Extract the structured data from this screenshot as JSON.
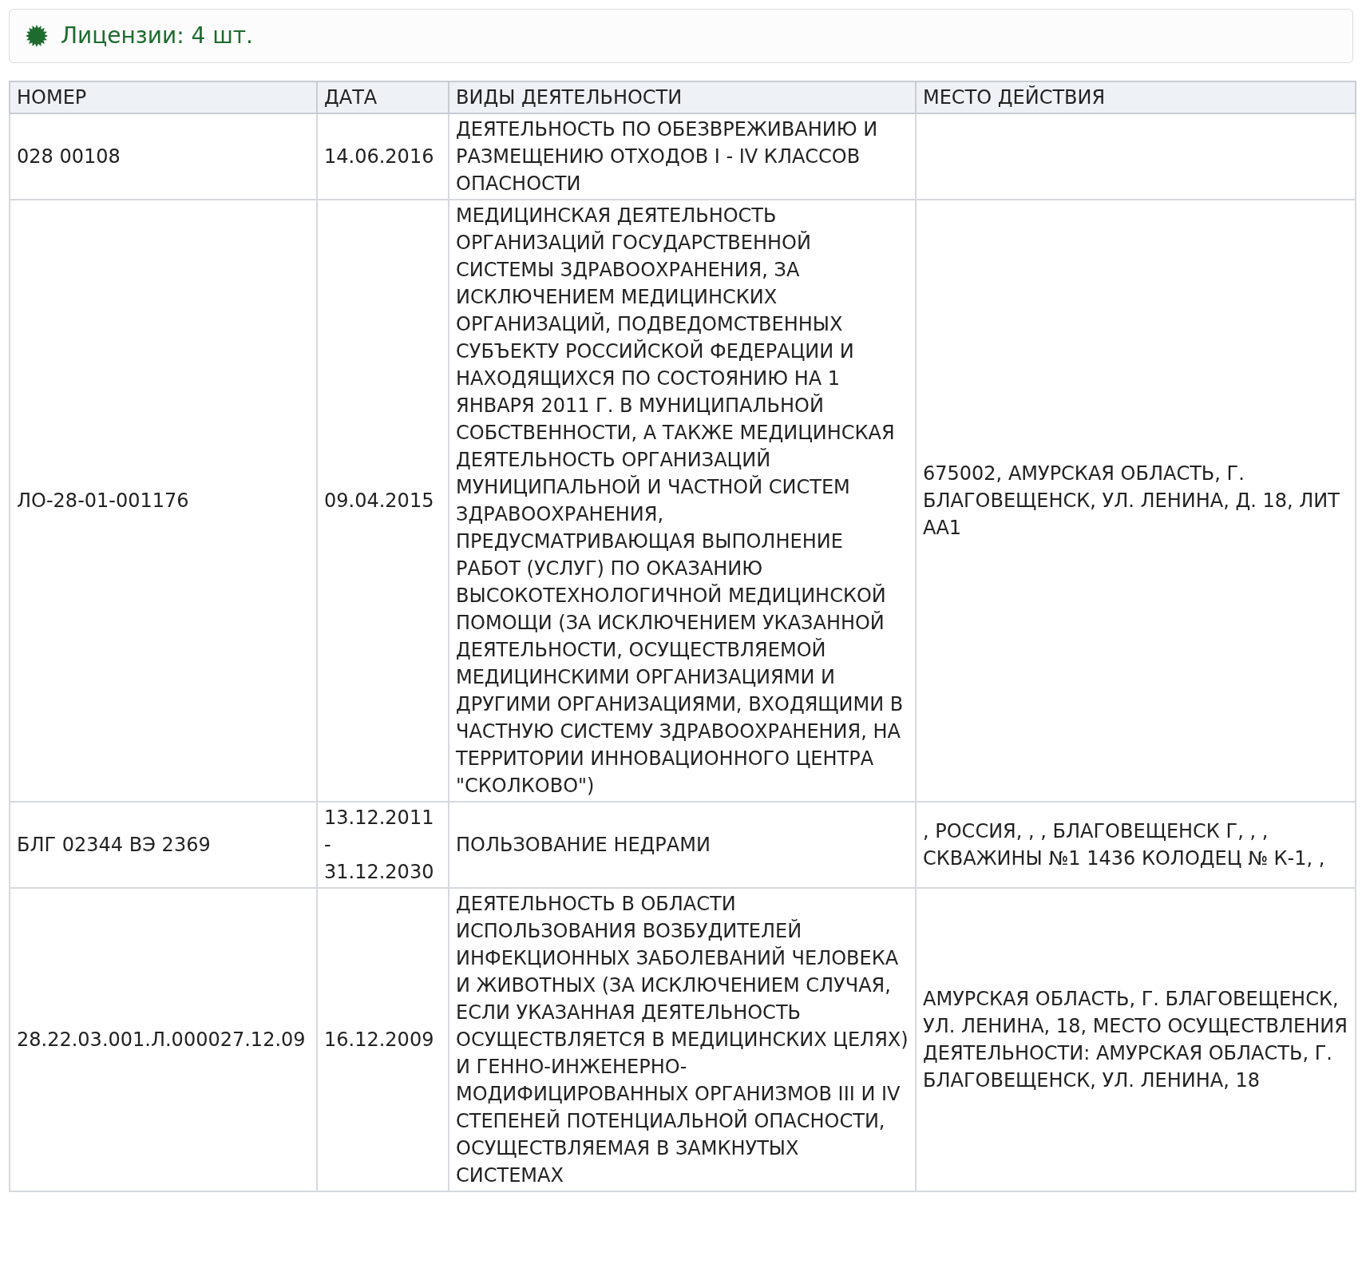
{
  "header": {
    "title": "Лицензии: 4 шт."
  },
  "table": {
    "columns": [
      "НОМЕР",
      "ДАТА",
      "ВИДЫ ДЕЯТЕЛЬНОСТИ",
      "МЕСТО ДЕЙСТВИЯ"
    ],
    "rows": [
      {
        "number": "028 00108",
        "date": "14.06.2016",
        "activity": "ДЕЯТЕЛЬНОСТЬ ПО ОБЕЗВРЕЖИВАНИЮ И РАЗМЕЩЕНИЮ ОТХОДОВ I - IV КЛАССОВ ОПАСНОСТИ",
        "place": ""
      },
      {
        "number": "ЛО-28-01-001176",
        "date": "09.04.2015",
        "activity": "МЕДИЦИНСКАЯ ДЕЯТЕЛЬНОСТЬ ОРГАНИЗАЦИЙ ГОСУДАРСТВЕННОЙ СИСТЕМЫ ЗДРАВООХРАНЕНИЯ, ЗА ИСКЛЮЧЕНИЕМ МЕДИЦИНСКИХ ОРГАНИЗАЦИЙ, ПОДВЕДОМСТВЕННЫХ СУБЪЕКТУ РОССИЙСКОЙ ФЕДЕРАЦИИ И НАХОДЯЩИХСЯ ПО СОСТОЯНИЮ НА 1 ЯНВАРЯ 2011 Г. В МУНИЦИПАЛЬНОЙ СОБСТВЕННОСТИ, А ТАКЖЕ МЕДИЦИНСКАЯ ДЕЯТЕЛЬНОСТЬ ОРГАНИЗАЦИЙ МУНИЦИПАЛЬНОЙ И ЧАСТНОЙ СИСТЕМ ЗДРАВООХРАНЕНИЯ, ПРЕДУСМАТРИВАЮЩАЯ ВЫПОЛНЕНИЕ РАБОТ (УСЛУГ) ПО ОКАЗАНИЮ ВЫСОКОТЕХНОЛОГИЧНОЙ МЕДИЦИНСКОЙ ПОМОЩИ (ЗА ИСКЛЮЧЕНИЕМ УКАЗАННОЙ ДЕЯТЕЛЬНОСТИ, ОСУЩЕСТВЛЯЕМОЙ МЕДИЦИНСКИМИ ОРГАНИЗАЦИЯМИ И ДРУГИМИ ОРГАНИЗАЦИЯМИ, ВХОДЯЩИМИ В ЧАСТНУЮ СИСТЕМУ ЗДРАВООХРАНЕНИЯ, НА ТЕРРИТОРИИ ИННОВАЦИОННОГО ЦЕНТРА \"СКОЛКОВО\")",
        "place": "675002, АМУРСКАЯ ОБЛАСТЬ, Г. БЛАГОВЕЩЕНСК, УЛ. ЛЕНИНА, Д. 18, ЛИТ АА1"
      },
      {
        "number": "БЛГ 02344 ВЭ 2369",
        "date": "13.12.2011 - 31.12.2030",
        "activity": "ПОЛЬЗОВАНИЕ НЕДРАМИ",
        "place": ", РОССИЯ, , , БЛАГОВЕЩЕНСК Г, , , СКВАЖИНЫ №1 1436 КОЛОДЕЦ № К-1, ,"
      },
      {
        "number": "28.22.03.001.Л.000027.12.09",
        "date": "16.12.2009",
        "activity": "ДЕЯТЕЛЬНОСТЬ В ОБЛАСТИ ИСПОЛЬЗОВАНИЯ ВОЗБУДИТЕЛЕЙ ИНФЕКЦИОННЫХ ЗАБОЛЕВАНИЙ ЧЕЛОВЕКА И ЖИВОТНЫХ (ЗА ИСКЛЮЧЕНИЕМ СЛУЧАЯ, ЕСЛИ УКАЗАННАЯ ДЕЯТЕЛЬНОСТЬ ОСУЩЕСТВЛЯЕТСЯ В МЕДИЦИНСКИХ ЦЕЛЯХ) И ГЕННО-ИНЖЕНЕРНО-МОДИФИЦИРОВАННЫХ ОРГАНИЗМОВ III И IV СТЕПЕНЕЙ ПОТЕНЦИАЛЬНОЙ ОПАСНОСТИ, ОСУЩЕСТВЛЯЕМАЯ В ЗАМКНУТЫХ СИСТЕМАХ",
        "place": "АМУРСКАЯ ОБЛАСТЬ, Г. БЛАГОВЕЩЕНСК, УЛ. ЛЕНИНА, 18, МЕСТО ОСУЩЕСТВЛЕНИЯ ДЕЯТЕЛЬНОСТИ: АМУРСКАЯ ОБЛАСТЬ, Г. БЛАГОВЕЩЕНСК, УЛ. ЛЕНИНА, 18"
      }
    ]
  }
}
